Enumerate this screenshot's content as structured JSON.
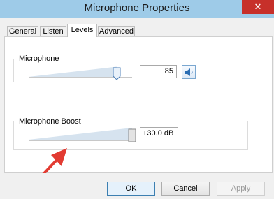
{
  "window": {
    "title": "Microphone Properties",
    "close_glyph": "✕"
  },
  "tabs": [
    {
      "label": "General",
      "active": false
    },
    {
      "label": "Listen",
      "active": false
    },
    {
      "label": "Levels",
      "active": true
    },
    {
      "label": "Advanced",
      "active": false
    }
  ],
  "microphone": {
    "label": "Microphone",
    "value": "85",
    "level": 0.85,
    "mute_icon": "speaker-icon"
  },
  "boost": {
    "label": "Microphone Boost",
    "value": "+30.0 dB",
    "level": 1.0
  },
  "buttons": {
    "ok": "OK",
    "cancel": "Cancel",
    "apply": "Apply"
  },
  "annotation": {
    "icon": "red-arrow-icon",
    "color": "#e23b32"
  },
  "colors": {
    "titlebar": "#9ecbe8",
    "close": "#c7302a",
    "slider_fill": "#d6e3ef",
    "thumb": "#e8f1fa"
  }
}
